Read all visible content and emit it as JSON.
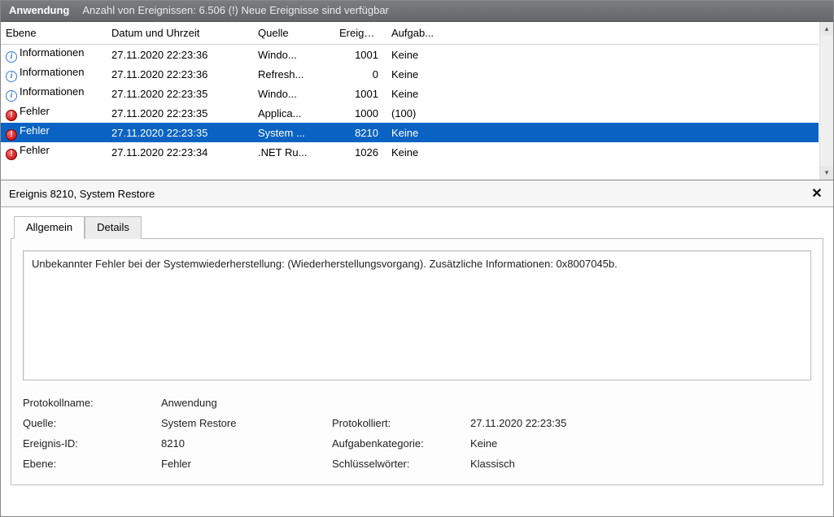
{
  "title": {
    "app": "Anwendung",
    "count": "Anzahl von Ereignissen: 6.506 (!) Neue Ereignisse sind verfügbar"
  },
  "columns": {
    "level": "Ebene",
    "datetime": "Datum und Uhrzeit",
    "source": "Quelle",
    "eventid": "Ereigni...",
    "task": "Aufgab..."
  },
  "rows": [
    {
      "level_icon": "info",
      "level": "Informationen",
      "datetime": "27.11.2020 22:23:36",
      "source": "Windo...",
      "eventid": "1001",
      "task": "Keine",
      "selected": false
    },
    {
      "level_icon": "info",
      "level": "Informationen",
      "datetime": "27.11.2020 22:23:36",
      "source": "Refresh...",
      "eventid": "0",
      "task": "Keine",
      "selected": false
    },
    {
      "level_icon": "info",
      "level": "Informationen",
      "datetime": "27.11.2020 22:23:35",
      "source": "Windo...",
      "eventid": "1001",
      "task": "Keine",
      "selected": false
    },
    {
      "level_icon": "error",
      "level": "Fehler",
      "datetime": "27.11.2020 22:23:35",
      "source": "Applica...",
      "eventid": "1000",
      "task": "(100)",
      "selected": false
    },
    {
      "level_icon": "error",
      "level": "Fehler",
      "datetime": "27.11.2020 22:23:35",
      "source": "System ...",
      "eventid": "8210",
      "task": "Keine",
      "selected": true
    },
    {
      "level_icon": "error",
      "level": "Fehler",
      "datetime": "27.11.2020 22:23:34",
      "source": ".NET Ru...",
      "eventid": "1026",
      "task": "Keine",
      "selected": false
    }
  ],
  "detail": {
    "header": "Ereignis 8210, System Restore",
    "tabs": {
      "general": "Allgemein",
      "details": "Details"
    },
    "description": "Unbekannter Fehler bei der Systemwiederherstellung: (Wiederherstellungsvorgang). Zusätzliche Informationen: 0x8007045b.",
    "props": {
      "log_name_k": "Protokollname:",
      "log_name_v": "Anwendung",
      "source_k": "Quelle:",
      "source_v": "System Restore",
      "logged_k": "Protokolliert:",
      "logged_v": "27.11.2020 22:23:35",
      "eventid_k": "Ereignis-ID:",
      "eventid_v": "8210",
      "taskcat_k": "Aufgabenkategorie:",
      "taskcat_v": "Keine",
      "level_k": "Ebene:",
      "level_v": "Fehler",
      "keywords_k": "Schlüsselwörter:",
      "keywords_v": "Klassisch"
    }
  }
}
